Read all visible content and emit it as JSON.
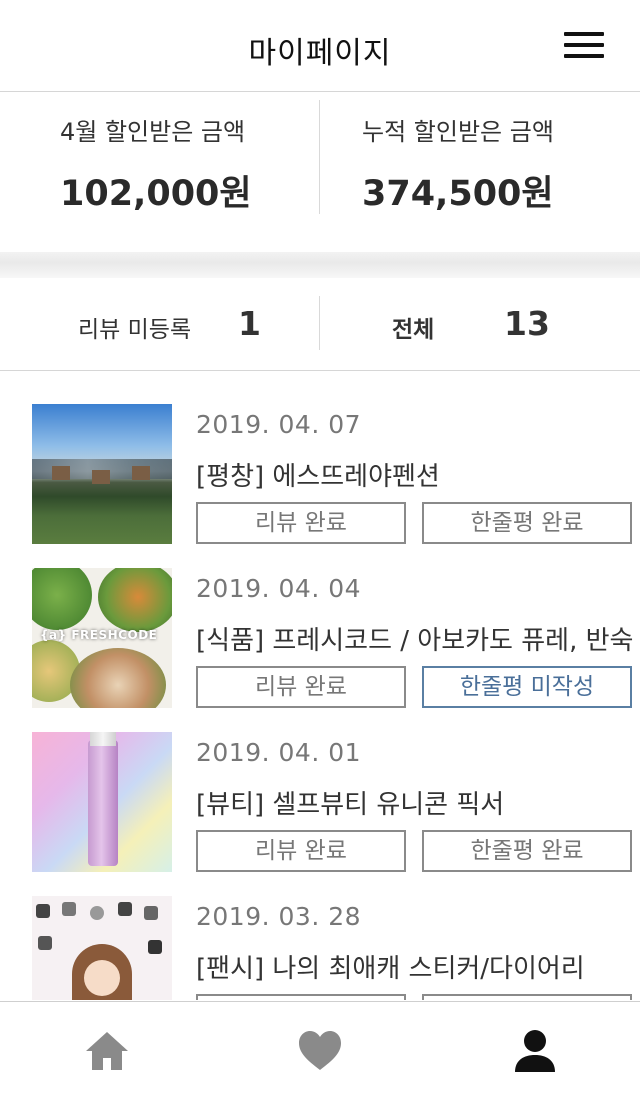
{
  "header": {
    "title": "마이페이지",
    "menu_icon": "hamburger-menu-icon"
  },
  "summary": {
    "month": {
      "label": "4월 할인받은 금액",
      "value": "102,000원"
    },
    "total": {
      "label": "누적 할인받은 금액",
      "value": "374,500원"
    }
  },
  "counts": {
    "unregistered": {
      "label": "리뷰 미등록",
      "value": "1"
    },
    "all": {
      "label": "전체",
      "value": "13"
    }
  },
  "items": [
    {
      "date": "2019. 04. 07",
      "title": "[평창] 에스뜨레야펜션",
      "review_button": "리뷰 완료",
      "oneline_button": "한줄평 완료",
      "thumb_alt": "pension-photo"
    },
    {
      "date": "2019. 04. 04",
      "title": "[식품] 프레시코드 / 아보카도 퓨레, 반숙",
      "review_button": "리뷰 완료",
      "oneline_button": "한줄평 미작성",
      "thumb_brand": "{a} FRESHCODE"
    },
    {
      "date": "2019. 04. 01",
      "title": "[뷰티] 셀프뷰티 유니콘 픽서",
      "review_button": "리뷰 완료",
      "oneline_button": "한줄평 완료"
    },
    {
      "date": "2019. 03. 28",
      "title": "[팬시] 나의 최애캐 스티커/다이어리",
      "review_button": "",
      "oneline_button": ""
    }
  ],
  "tabbar": {
    "icons": [
      "home-icon",
      "heart-icon",
      "person-icon"
    ],
    "active": "person-icon"
  },
  "colors": {
    "pending_accent": "#4a6f99",
    "tab_inactive": "#8a8a8a",
    "tab_active": "#111111"
  }
}
